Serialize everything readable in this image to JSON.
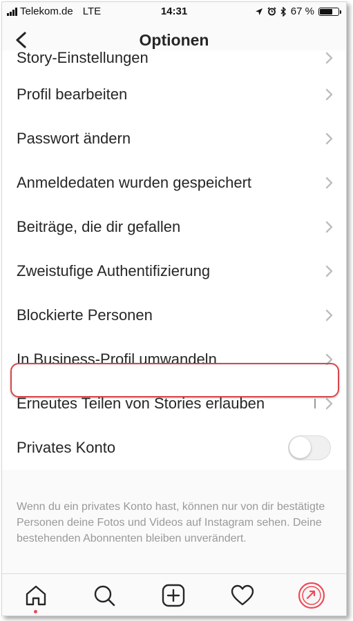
{
  "status_bar": {
    "carrier": "Telekom.de",
    "network": "LTE",
    "time": "14:31",
    "battery": "67 %"
  },
  "nav": {
    "title": "Optionen"
  },
  "settings": [
    {
      "label": "Story-Einstellungen"
    },
    {
      "label": "Profil bearbeiten"
    },
    {
      "label": "Passwort ändern"
    },
    {
      "label": "Anmeldedaten wurden gespeichert"
    },
    {
      "label": "Beiträge, die dir gefallen"
    },
    {
      "label": "Zweistufige Authentifizierung"
    },
    {
      "label": "Blockierte Personen"
    },
    {
      "label": "In Business-Profil umwandeln"
    },
    {
      "label": "Erneutes Teilen von Stories erlauben"
    }
  ],
  "private_account": {
    "label": "Privates Konto",
    "enabled": false,
    "description": "Wenn du ein privates Konto hast, können nur von dir bestätigte Personen deine Fotos und Videos auf Instagram sehen. Deine bestehenden Abonnenten bleiben unverändert."
  },
  "colors": {
    "highlight": "#d9444a",
    "text": "#262626",
    "muted": "#999999",
    "notification_dot": "#ed4956"
  },
  "tab_bar": {
    "icons": [
      "home-icon",
      "search-icon",
      "add-post-icon",
      "activity-heart-icon",
      "profile-icon"
    ]
  }
}
